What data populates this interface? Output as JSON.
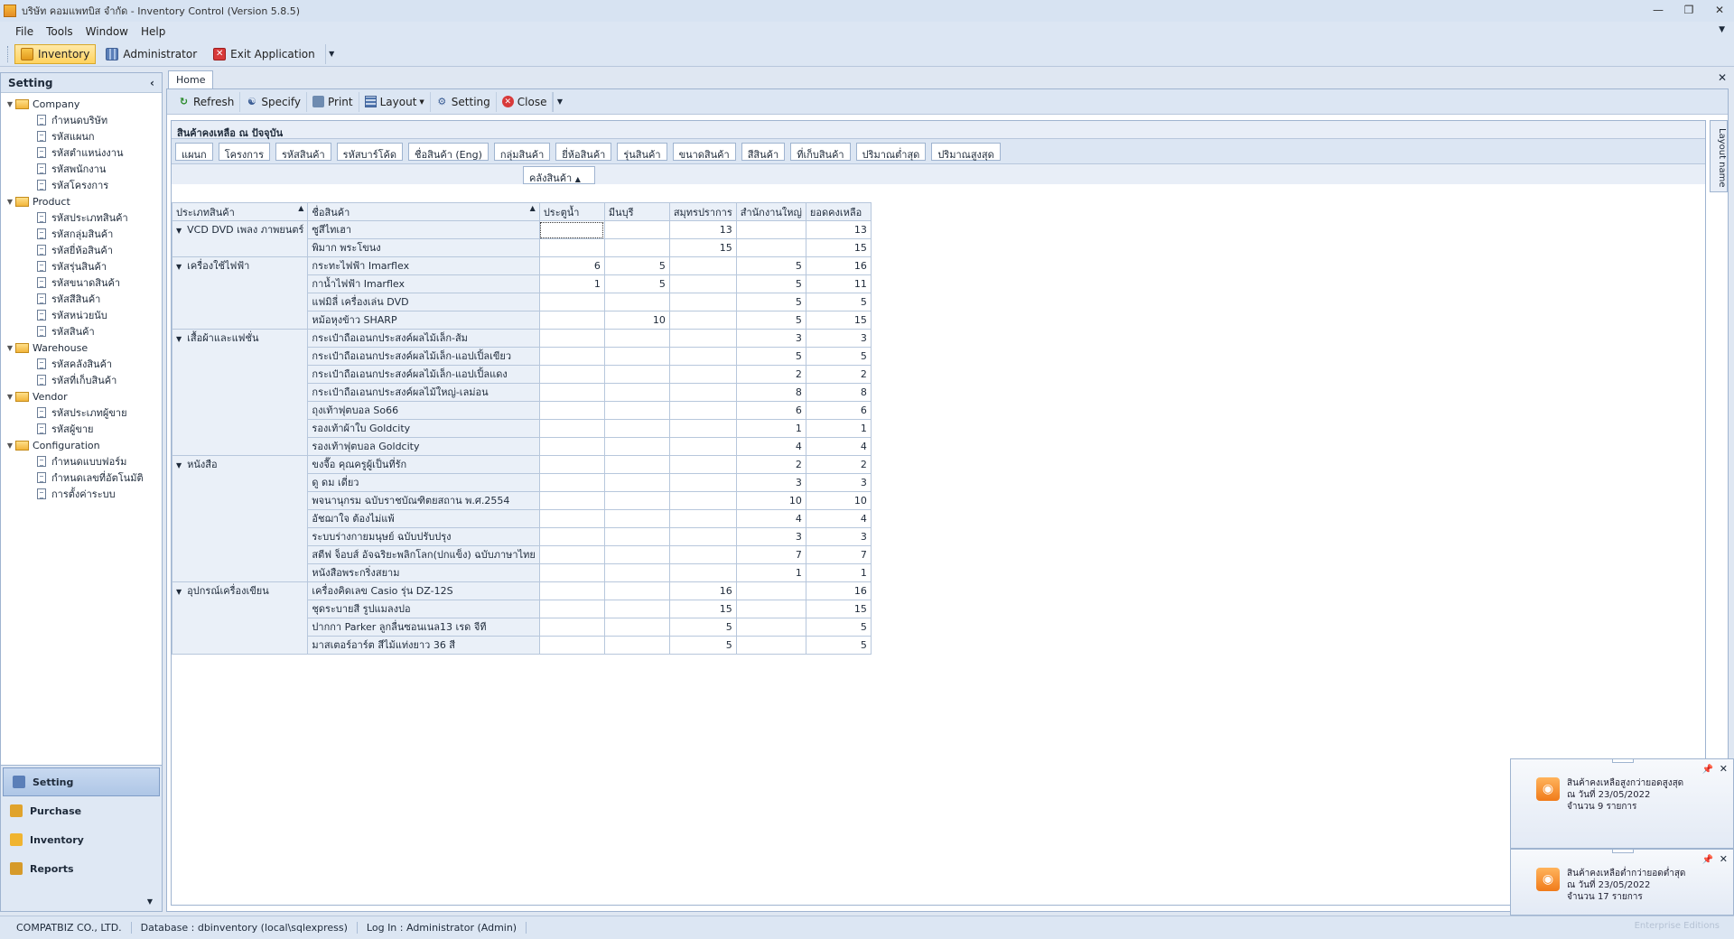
{
  "window": {
    "title": "บริษัท คอมแพทบิส จำกัด - Inventory Control (Version 5.8.5)"
  },
  "menu": [
    "File",
    "Tools",
    "Window",
    "Help"
  ],
  "toolbar": {
    "inventory": "Inventory",
    "administrator": "Administrator",
    "exit": "Exit Application"
  },
  "sidebar": {
    "title": "Setting",
    "groups": [
      {
        "label": "Company",
        "items": [
          "กำหนดบริษัท",
          "รหัสแผนก",
          "รหัสตำแหน่งงาน",
          "รหัสพนักงาน",
          "รหัสโครงการ"
        ]
      },
      {
        "label": "Product",
        "items": [
          "รหัสประเภทสินค้า",
          "รหัสกลุ่มสินค้า",
          "รหัสยี่ห้อสินค้า",
          "รหัสรุ่นสินค้า",
          "รหัสขนาดสินค้า",
          "รหัสสีสินค้า",
          "รหัสหน่วยนับ",
          "รหัสสินค้า"
        ]
      },
      {
        "label": "Warehouse",
        "items": [
          "รหัสคลังสินค้า",
          "รหัสที่เก็บสินค้า"
        ]
      },
      {
        "label": "Vendor",
        "items": [
          "รหัสประเภทผู้ขาย",
          "รหัสผู้ขาย"
        ]
      },
      {
        "label": "Configuration",
        "items": [
          "กำหนดแบบฟอร์ม",
          "กำหนดเลขที่อัตโนมัติ",
          "การตั้งค่าระบบ"
        ]
      }
    ],
    "nav": [
      "Setting",
      "Purchase",
      "Inventory",
      "Reports"
    ]
  },
  "tabs": {
    "home": "Home"
  },
  "actions": {
    "refresh": "Refresh",
    "specify": "Specify",
    "print": "Print",
    "layout": "Layout",
    "setting": "Setting",
    "close": "Close"
  },
  "pivot": {
    "title": "สินค้าคงเหลือ ณ ปัจจุบัน",
    "filter_fields": [
      "แผนก",
      "โครงการ",
      "รหัสสินค้า",
      "รหัสบาร์โค้ด",
      "ชื่อสินค้า (Eng)",
      "กลุ่มสินค้า",
      "ยี่ห้อสินค้า",
      "รุ่นสินค้า",
      "ขนาดสินค้า",
      "สีสินค้า",
      "ที่เก็บสินค้า",
      "ปริมาณต่ำสุด",
      "ปริมาณสูงสุด"
    ],
    "column_field": "คลังสินค้า",
    "row_fields": [
      "ประเภทสินค้า",
      "ชื่อสินค้า"
    ],
    "columns": [
      "ประตูน้ำ",
      "มีนบุรี",
      "สมุทรปราการ",
      "สำนักงานใหญ่",
      "ยอดคงเหลือ"
    ],
    "groups": [
      {
        "type": "VCD DVD เพลง ภาพยนตร์",
        "rows": [
          {
            "name": "ซูสีไทเฮา",
            "v": [
              "",
              "",
              "13",
              "",
              "13"
            ]
          },
          {
            "name": "พิมาก พระโขนง",
            "v": [
              "",
              "",
              "15",
              "",
              "15"
            ]
          }
        ]
      },
      {
        "type": "เครื่องใช้ไฟฟ้า",
        "rows": [
          {
            "name": "กระทะไฟฟ้า Imarflex",
            "v": [
              "6",
              "5",
              "",
              "5",
              "16"
            ]
          },
          {
            "name": "กาน้ำไฟฟ้า Imarflex",
            "v": [
              "1",
              "5",
              "",
              "5",
              "11"
            ]
          },
          {
            "name": "แฟมิลี่ เครื่องเล่น DVD",
            "v": [
              "",
              "",
              "",
              "5",
              "5"
            ]
          },
          {
            "name": "หม้อหุงข้าว SHARP",
            "v": [
              "",
              "10",
              "",
              "5",
              "15"
            ]
          }
        ]
      },
      {
        "type": "เสื้อผ้าและแฟชั่น",
        "rows": [
          {
            "name": "กระเป๋าถือเอนกประสงค์ผลไม้เล็ก-ส้ม",
            "v": [
              "",
              "",
              "",
              "3",
              "3"
            ]
          },
          {
            "name": "กระเป๋าถือเอนกประสงค์ผลไม้เล็ก-แอปเปิ้ลเขียว",
            "v": [
              "",
              "",
              "",
              "5",
              "5"
            ]
          },
          {
            "name": "กระเป๋าถือเอนกประสงค์ผลไม้เล็ก-แอปเปิ้ลแดง",
            "v": [
              "",
              "",
              "",
              "2",
              "2"
            ]
          },
          {
            "name": "กระเป๋าถือเอนกประสงค์ผลไม้ใหญ่-เลม่อน",
            "v": [
              "",
              "",
              "",
              "8",
              "8"
            ]
          },
          {
            "name": "ถุงเท้าฟุตบอล So66",
            "v": [
              "",
              "",
              "",
              "6",
              "6"
            ]
          },
          {
            "name": "รองเท้าผ้าใบ Goldcity",
            "v": [
              "",
              "",
              "",
              "1",
              "1"
            ]
          },
          {
            "name": "รองเท้าฟุตบอล Goldcity",
            "v": [
              "",
              "",
              "",
              "4",
              "4"
            ]
          }
        ]
      },
      {
        "type": "หนังสือ",
        "rows": [
          {
            "name": "ขงจื๊อ คุณครูผู้เป็นที่รัก",
            "v": [
              "",
              "",
              "",
              "2",
              "2"
            ]
          },
          {
            "name": "ดู ดม เดี่ยว",
            "v": [
              "",
              "",
              "",
              "3",
              "3"
            ]
          },
          {
            "name": "พจนานุกรม ฉบับราชบัณฑิตยสถาน พ.ศ.2554",
            "v": [
              "",
              "",
              "",
              "10",
              "10"
            ]
          },
          {
            "name": "อัชฌาใจ ต้องไม่แพ้",
            "v": [
              "",
              "",
              "",
              "4",
              "4"
            ]
          },
          {
            "name": "ระบบร่างกายมนุษย์ ฉบับปรับปรุง",
            "v": [
              "",
              "",
              "",
              "3",
              "3"
            ]
          },
          {
            "name": "สตีฟ จ็อบส์ อัจฉริยะพลิกโลก(ปกแข็ง) ฉบับภาษาไทย",
            "v": [
              "",
              "",
              "",
              "7",
              "7"
            ]
          },
          {
            "name": "หนังสือพระกริ่งสยาม",
            "v": [
              "",
              "",
              "",
              "1",
              "1"
            ]
          }
        ]
      },
      {
        "type": "อุปกรณ์เครื่องเขียน",
        "rows": [
          {
            "name": "เครื่องคิดเลข Casio รุ่น DZ-12S",
            "v": [
              "",
              "",
              "16",
              "",
              "16"
            ]
          },
          {
            "name": "ชุดระบายสี รูปแมลงปอ",
            "v": [
              "",
              "",
              "15",
              "",
              "15"
            ]
          },
          {
            "name": "ปากกา Parker ลูกลื่นซอนเนล13 เรด จีที",
            "v": [
              "",
              "",
              "5",
              "",
              "5"
            ]
          },
          {
            "name": "มาสเตอร์อาร์ต สีไม้แท่งยาว 36 สี",
            "v": [
              "",
              "",
              "5",
              "",
              "5"
            ]
          }
        ]
      }
    ]
  },
  "layout_tab": "Layout name",
  "notifications": [
    {
      "line1": "สินค้าคงเหลือสูงกว่ายอดสูงสุด",
      "line2": "ณ วันที่ 23/05/2022",
      "line3": "จำนวน 9 รายการ"
    },
    {
      "line1": "สินค้าคงเหลือต่ำกว่ายอดต่ำสุด",
      "line2": "ณ วันที่ 23/05/2022",
      "line3": "จำนวน 17 รายการ"
    }
  ],
  "status": {
    "company": "COMPATBIZ CO., LTD.",
    "database": "Database : dbinventory (local\\sqlexpress)",
    "login": "Log In : Administrator (Admin)",
    "edition": "Enterprise Editions"
  }
}
